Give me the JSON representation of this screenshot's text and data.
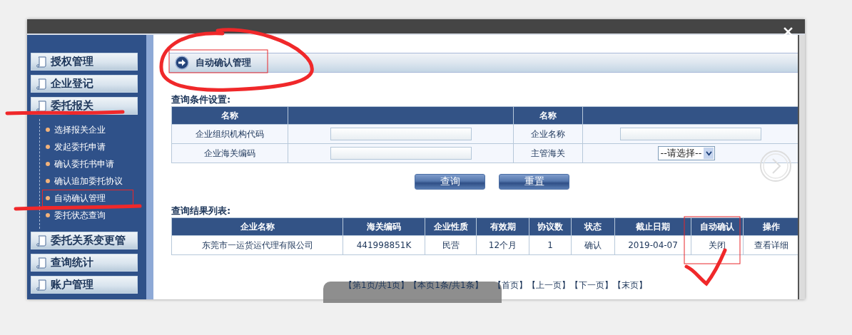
{
  "sidebar": {
    "sections": [
      {
        "label": "授权管理"
      },
      {
        "label": "企业登记"
      },
      {
        "label": "委托报关",
        "children": [
          {
            "label": "选择报关企业",
            "selected": false
          },
          {
            "label": "发起委托申请",
            "selected": false
          },
          {
            "label": "确认委托书申请",
            "selected": false
          },
          {
            "label": "确认追加委托协议",
            "selected": false
          },
          {
            "label": "自动确认管理",
            "selected": true
          },
          {
            "label": "委托状态查询",
            "selected": false
          }
        ]
      },
      {
        "label": "委托关系变更管"
      },
      {
        "label": "查询统计"
      },
      {
        "label": "账户管理"
      }
    ]
  },
  "panel": {
    "title": "自动确认管理"
  },
  "query": {
    "title": "查询条件设置:",
    "header": [
      "名称",
      "名称"
    ],
    "rows": [
      [
        {
          "label": "企业组织机构代码",
          "kind": "text"
        },
        {
          "label": "企业名称",
          "kind": "text"
        }
      ],
      [
        {
          "label": "企业海关编码",
          "kind": "text"
        },
        {
          "label": "主管海关",
          "kind": "select",
          "value": "--请选择--"
        }
      ]
    ],
    "buttons": [
      "查询",
      "重置"
    ]
  },
  "results": {
    "title": "查询结果列表:",
    "columns": [
      "企业名称",
      "海关编码",
      "企业性质",
      "有效期",
      "协议数",
      "状态",
      "截止日期",
      "自动确认",
      "操作"
    ],
    "rows": [
      [
        "东莞市一运货运代理有限公司",
        "441998851K",
        "民营",
        "12个月",
        "1",
        "确认",
        "2019-04-07",
        "关闭",
        "查看详细"
      ]
    ]
  },
  "pagination": {
    "status": "【第1页/共1页】【本页1条/共1条】",
    "links": [
      "【首页】",
      "【上一页】",
      "【下一页】",
      "【末页】"
    ]
  }
}
